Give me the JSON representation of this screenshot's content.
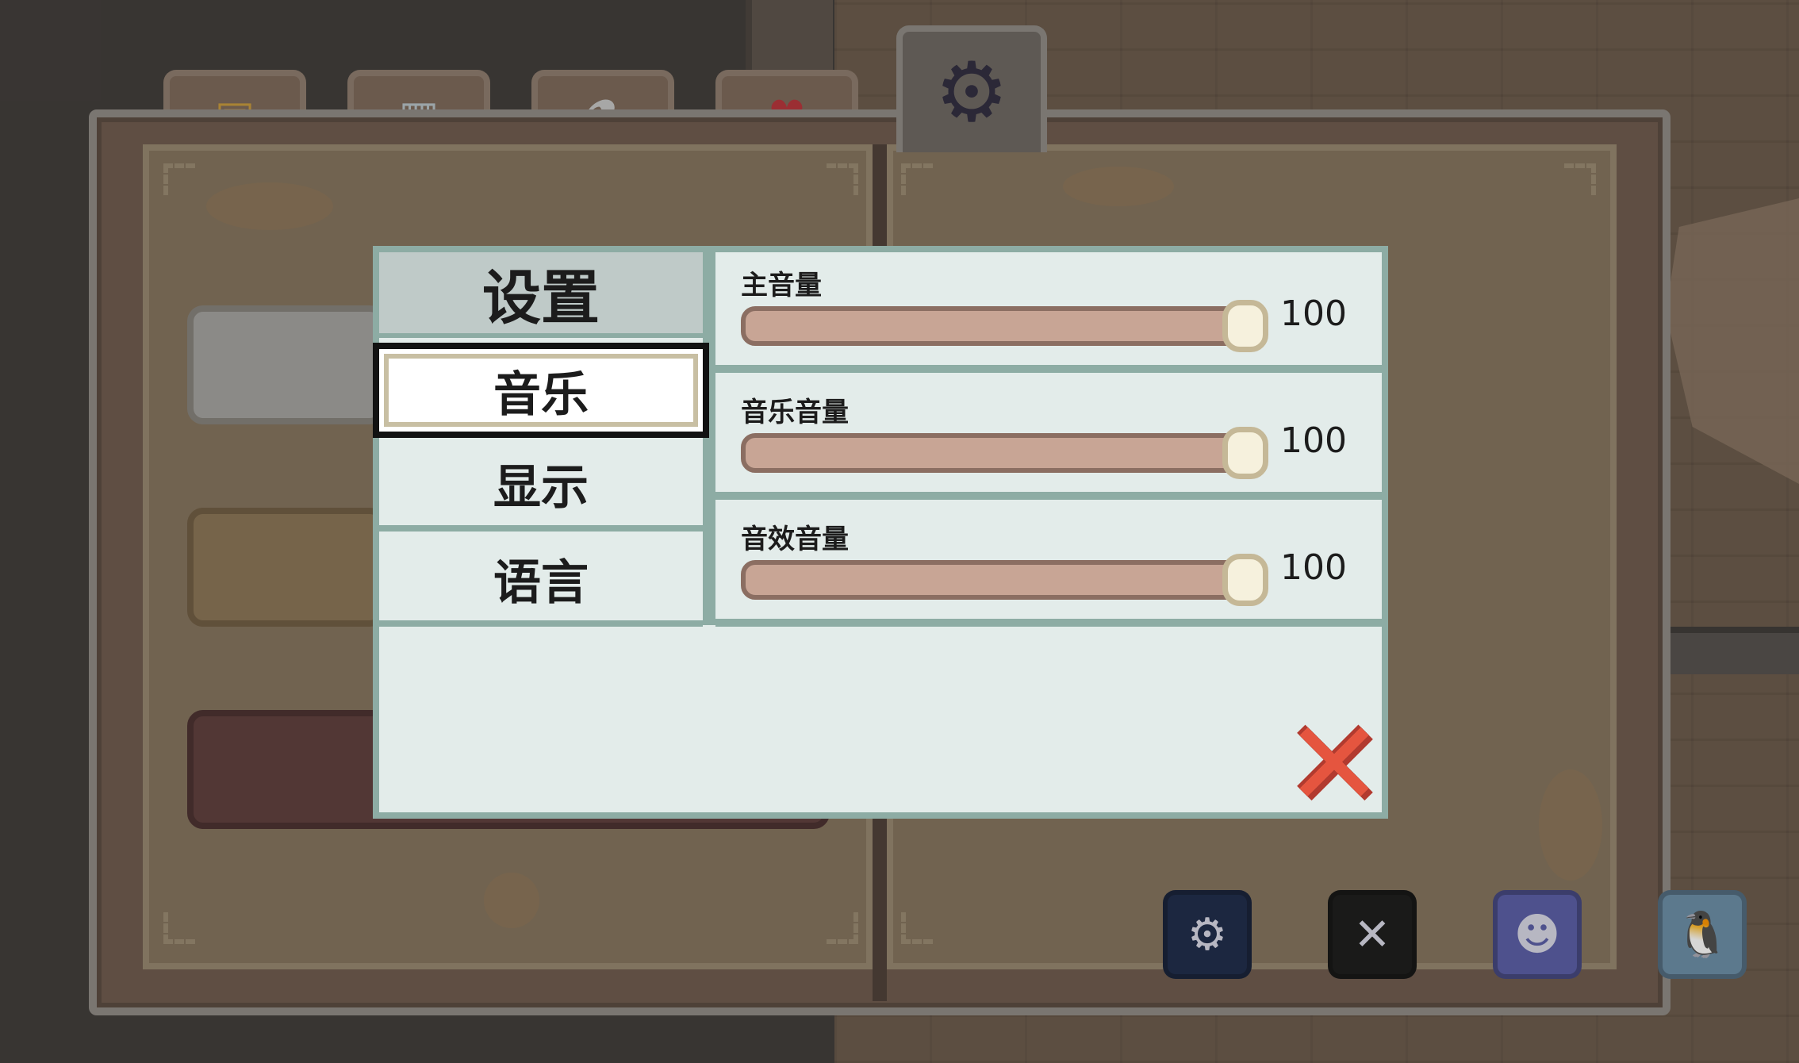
{
  "settings": {
    "title": "设置",
    "tabs": [
      {
        "label": "音乐",
        "selected": true
      },
      {
        "label": "显示",
        "selected": false
      },
      {
        "label": "语言",
        "selected": false
      }
    ],
    "volumes": [
      {
        "label": "主音量",
        "value": 100
      },
      {
        "label": "音乐音量",
        "value": 100
      },
      {
        "label": "音效音量",
        "value": 100
      }
    ],
    "close_icon": "close-x-icon"
  },
  "book_tabs": [
    {
      "icon": "treasure-chest-icon",
      "glyph": "▣",
      "color": "#c99a3b"
    },
    {
      "icon": "picture-frame-icon",
      "glyph": "▦",
      "color": "#b8c3c8"
    },
    {
      "icon": "flask-icon",
      "glyph": "⚗",
      "color": "#c6c6c6"
    },
    {
      "icon": "heart-icon",
      "glyph": "♥",
      "color": "#b8323a"
    }
  ],
  "active_tab_icon": {
    "icon": "gear-icon",
    "glyph": "⚙",
    "color": "#2f2b3f"
  },
  "social_icons": [
    {
      "icon": "steam-icon",
      "glyph": "⚙",
      "color": "#1d2a4a"
    },
    {
      "icon": "x-twitter-icon",
      "glyph": "✕",
      "color": "#1a1a1a"
    },
    {
      "icon": "discord-icon",
      "glyph": "☻",
      "color": "#5a5da8"
    },
    {
      "icon": "qq-penguin-icon",
      "glyph": "🐧",
      "color": "#6b8ea8"
    }
  ]
}
